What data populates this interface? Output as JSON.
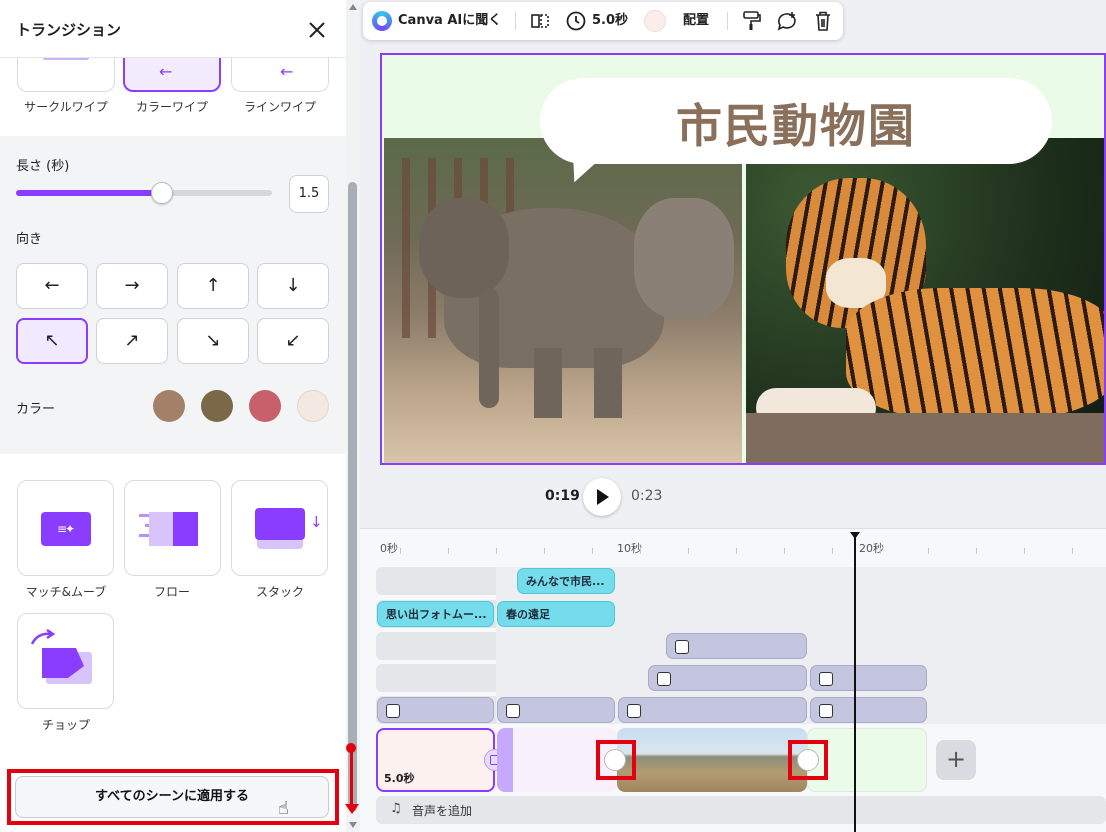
{
  "panel": {
    "title": "トランジション",
    "transitions_top": [
      "サークルワイプ",
      "カラーワイプ",
      "ラインワイプ"
    ],
    "length_label": "長さ (秒)",
    "length_value": "1.5",
    "length_fraction": 0.57,
    "direction_label": "向き",
    "directions": [
      "←",
      "→",
      "↑",
      "↓",
      "↖",
      "↗",
      "↘",
      "↙"
    ],
    "color_label": "カラー",
    "colors": [
      "#a38168",
      "#7b6846",
      "#c7606b",
      "#f4e8e2"
    ],
    "cards": [
      "マッチ&ムーブ",
      "フロー",
      "スタック",
      "チョップ"
    ],
    "apply_label": "すべてのシーンに適用する"
  },
  "toolbar": {
    "ask_ai": "Canva AIに聞く",
    "duration": "5.0秒",
    "arrange": "配置"
  },
  "slide": {
    "heading": "市民動物園"
  },
  "playbar": {
    "current": "0:19",
    "total": "0:23"
  },
  "timeline": {
    "ruler": [
      "0秒",
      "10秒",
      "20秒"
    ],
    "clip_minna": "みんなで市民...",
    "clip_omoide": "思い出フォトムー...",
    "clip_haru": "春の遠足",
    "scene_duration": "5.0秒",
    "add_audio": "音声を追加"
  },
  "accent": "#8b3dff",
  "highlight": "#e3000f"
}
